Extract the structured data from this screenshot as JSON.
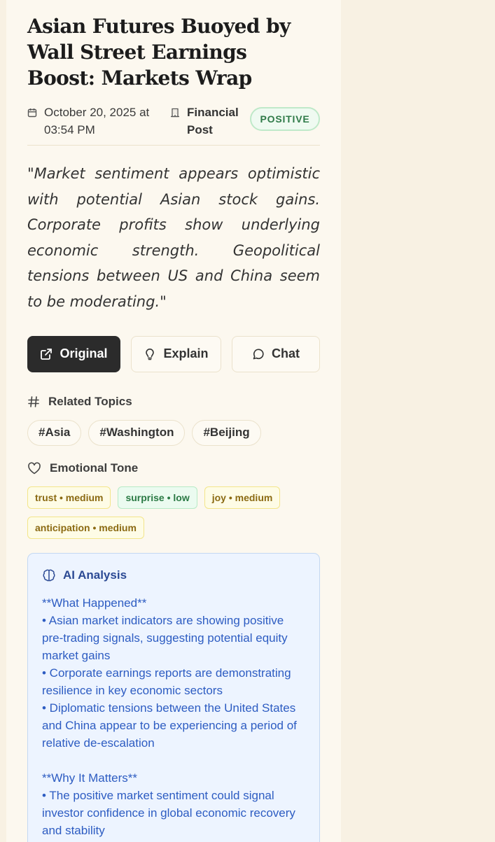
{
  "article": {
    "title": "Asian Futures Buoyed by Wall Street Earnings Boost: Markets Wrap",
    "date": "October 20, 2025 at 03:54 PM",
    "source": "Financial Post",
    "sentiment": "POSITIVE",
    "quote": "\"Market sentiment appears optimistic with potential Asian stock gains. Corporate profits show underlying economic strength. Geopolitical tensions between US and China seem to be moderating.\""
  },
  "actions": {
    "original": "Original",
    "explain": "Explain",
    "chat": "Chat"
  },
  "topics": {
    "heading": "Related Topics",
    "items": [
      "#Asia",
      "#Washington",
      "#Beijing"
    ]
  },
  "tone": {
    "heading": "Emotional Tone",
    "items": [
      {
        "label": "trust • medium",
        "color": "#8b6a12"
      },
      {
        "label": "surprise • low",
        "color": "#2b7a45"
      },
      {
        "label": "joy • medium",
        "color": "#8b6a12"
      },
      {
        "label": "anticipation • medium",
        "color": "#8b6a12"
      }
    ]
  },
  "analysis": {
    "heading": "AI Analysis",
    "body": "**What Happened**\n• Asian market indicators are showing positive pre-trading signals, suggesting potential equity market gains\n• Corporate earnings reports are demonstrating resilience in key economic sectors\n• Diplomatic tensions between the United States and China appear to be experiencing a period of relative de-escalation\n\n**Why It Matters**\n• The positive market sentiment could signal investor confidence in global economic recovery and stability\n• Strong corporate profits suggest underlying economic strength beyond headlines"
  },
  "icons": {
    "date": "calendar-icon",
    "source": "building-icon",
    "original": "external-link-icon",
    "explain": "lightbulb-icon",
    "chat": "chat-bubble-icon",
    "topics": "hash-icon",
    "tone": "heart-icon",
    "analysis": "brain-icon"
  },
  "colors": {
    "page_bg": "#f8f1e3",
    "card_bg": "#fcf8ef",
    "positive": "#2f7a48",
    "analysis_text": "#2d5cc2",
    "dark_button": "#2b2b2b"
  }
}
